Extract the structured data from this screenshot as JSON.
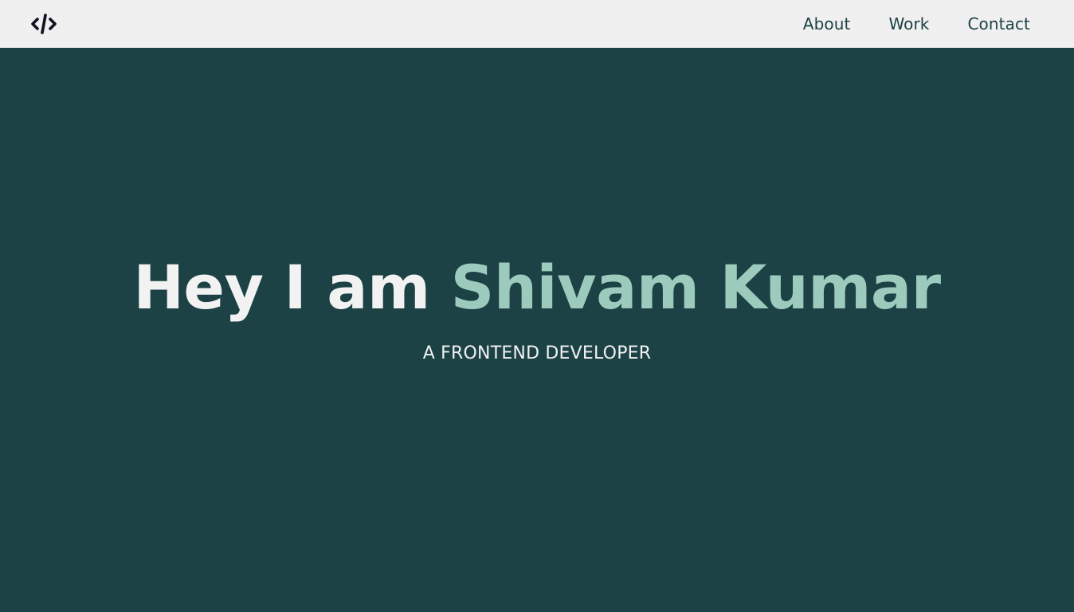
{
  "navbar": {
    "logo_icon": "code-brackets-icon",
    "links": [
      {
        "label": "About"
      },
      {
        "label": "Work"
      },
      {
        "label": "Contact"
      }
    ]
  },
  "hero": {
    "greeting": "Hey I am",
    "name": "Shivam Kumar",
    "subtitle": "A FRONTEND DEVELOPER"
  },
  "colors": {
    "navbar_bg": "#f0f0f0",
    "hero_bg": "#1c4245",
    "heading_text": "#f2f2f2",
    "name_accent": "#9ccbbe",
    "nav_text": "#1c4245",
    "logo": "#111122"
  }
}
